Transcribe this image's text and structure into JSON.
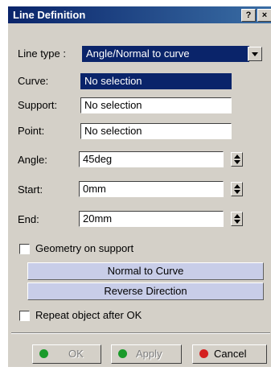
{
  "window": {
    "title": "Line Definition",
    "help_label": "?",
    "close_label": "×"
  },
  "line_type": {
    "label": "Line type :",
    "value": "Angle/Normal to curve"
  },
  "curve": {
    "label": "Curve:",
    "value": "No selection"
  },
  "support": {
    "label": "Support:",
    "value": "No selection"
  },
  "point": {
    "label": "Point:",
    "value": "No selection"
  },
  "angle": {
    "label": "Angle:",
    "value": "45deg"
  },
  "start": {
    "label": "Start:",
    "value": "0mm"
  },
  "end": {
    "label": "End:",
    "value": "20mm"
  },
  "geometry_on_support": {
    "label": "Geometry on support",
    "checked": false
  },
  "normal_to_curve_button": "Normal to Curve",
  "reverse_direction_button": "Reverse Direction",
  "repeat_object": {
    "label": "Repeat object after OK",
    "checked": false
  },
  "buttons": {
    "ok": "OK",
    "apply": "Apply",
    "cancel": "Cancel"
  },
  "colors": {
    "title_bar": "#0a246a",
    "selection": "#0a246a",
    "ok_dot": "#1a9a2a",
    "apply_dot": "#1a9a2a",
    "cancel_dot": "#d42020"
  }
}
